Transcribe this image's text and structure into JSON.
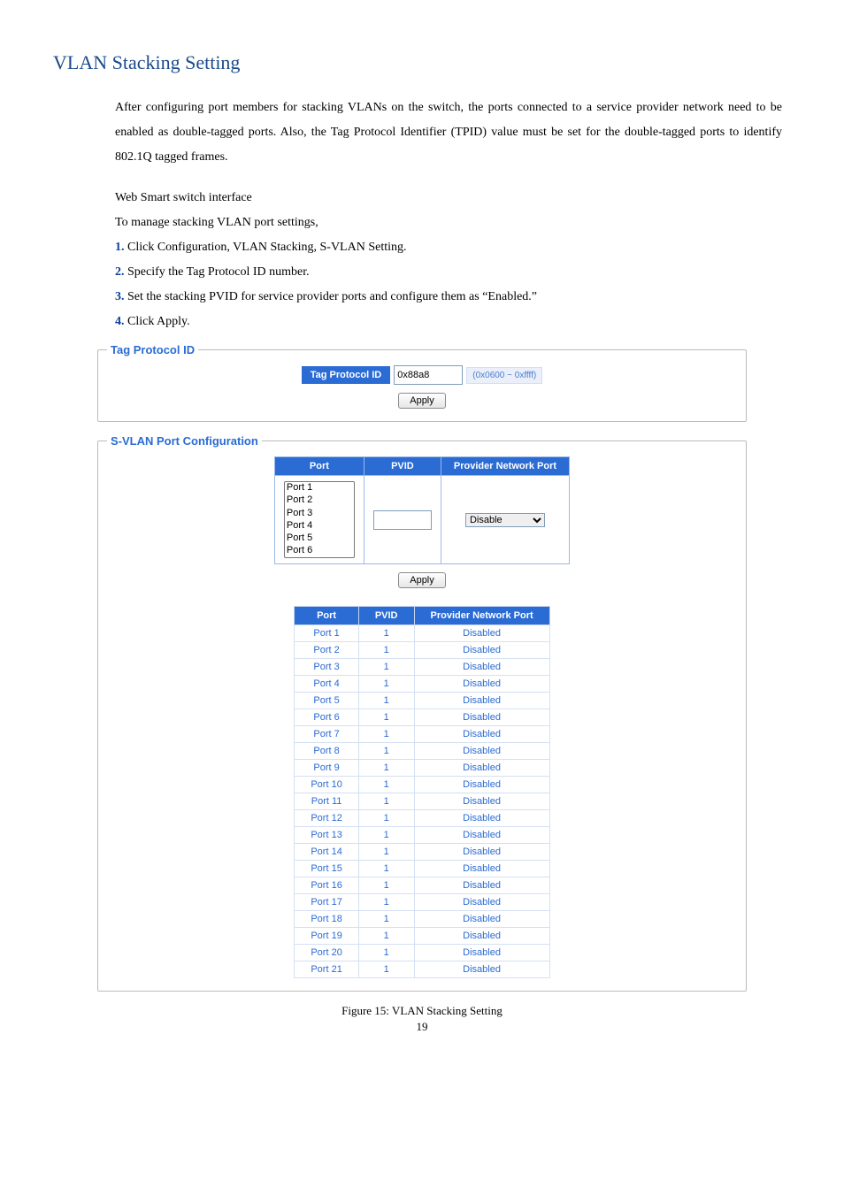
{
  "title": "VLAN Stacking Setting",
  "intro": "After configuring port members for stacking VLANs on the switch, the ports connected to a service provider network need to be enabled as double-tagged ports. Also, the Tag Protocol Identifier (TPID) value must be set for the double-tagged ports to identify 802.1Q tagged frames.",
  "intro2": "Web Smart switch interface",
  "intro3": "To manage stacking VLAN port settings,",
  "steps": [
    {
      "n": "1.",
      "t": " Click Configuration, VLAN Stacking, S-VLAN Setting."
    },
    {
      "n": "2.",
      "t": " Specify the Tag Protocol ID number."
    },
    {
      "n": "3.",
      "t": " Set the stacking PVID for service provider ports and configure them as “Enabled.”"
    },
    {
      "n": "4.",
      "t": " Click Apply."
    }
  ],
  "tpid": {
    "legend": "Tag Protocol ID",
    "label": "Tag Protocol ID",
    "value": "0x88a8",
    "hint": "(0x0600 ~ 0xffff)",
    "apply": "Apply"
  },
  "cfg": {
    "legend": "S-VLAN Port Configuration",
    "headers": {
      "port": "Port",
      "pvid": "PVID",
      "pnp": "Provider Network Port"
    },
    "port_options": [
      "Port 1",
      "Port 2",
      "Port 3",
      "Port 4",
      "Port 5",
      "Port 6"
    ],
    "pvid_value": "",
    "pnp_selected": "Disable",
    "apply": "Apply"
  },
  "status": {
    "headers": {
      "port": "Port",
      "pvid": "PVID",
      "pnp": "Provider Network Port"
    },
    "rows": [
      {
        "port": "Port 1",
        "pvid": "1",
        "pnp": "Disabled"
      },
      {
        "port": "Port 2",
        "pvid": "1",
        "pnp": "Disabled"
      },
      {
        "port": "Port 3",
        "pvid": "1",
        "pnp": "Disabled"
      },
      {
        "port": "Port 4",
        "pvid": "1",
        "pnp": "Disabled"
      },
      {
        "port": "Port 5",
        "pvid": "1",
        "pnp": "Disabled"
      },
      {
        "port": "Port 6",
        "pvid": "1",
        "pnp": "Disabled"
      },
      {
        "port": "Port 7",
        "pvid": "1",
        "pnp": "Disabled"
      },
      {
        "port": "Port 8",
        "pvid": "1",
        "pnp": "Disabled"
      },
      {
        "port": "Port 9",
        "pvid": "1",
        "pnp": "Disabled"
      },
      {
        "port": "Port 10",
        "pvid": "1",
        "pnp": "Disabled"
      },
      {
        "port": "Port 11",
        "pvid": "1",
        "pnp": "Disabled"
      },
      {
        "port": "Port 12",
        "pvid": "1",
        "pnp": "Disabled"
      },
      {
        "port": "Port 13",
        "pvid": "1",
        "pnp": "Disabled"
      },
      {
        "port": "Port 14",
        "pvid": "1",
        "pnp": "Disabled"
      },
      {
        "port": "Port 15",
        "pvid": "1",
        "pnp": "Disabled"
      },
      {
        "port": "Port 16",
        "pvid": "1",
        "pnp": "Disabled"
      },
      {
        "port": "Port 17",
        "pvid": "1",
        "pnp": "Disabled"
      },
      {
        "port": "Port 18",
        "pvid": "1",
        "pnp": "Disabled"
      },
      {
        "port": "Port 19",
        "pvid": "1",
        "pnp": "Disabled"
      },
      {
        "port": "Port 20",
        "pvid": "1",
        "pnp": "Disabled"
      },
      {
        "port": "Port 21",
        "pvid": "1",
        "pnp": "Disabled"
      }
    ]
  },
  "figure_caption": "Figure 15: VLAN Stacking Setting",
  "page_number": "19"
}
